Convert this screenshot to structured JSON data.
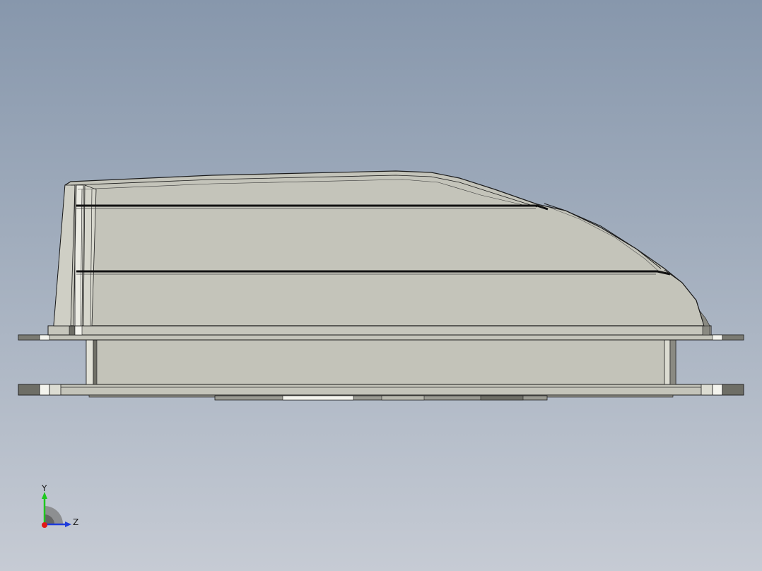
{
  "viewport": {
    "background_top": "#8797ac",
    "background_bottom": "#c6cbd4",
    "model": {
      "description_icon": "roof-vent-cover-model",
      "fill_color": "#c3c3b9",
      "edge_color": "#1b1b1b"
    }
  },
  "triad": {
    "y_label": "Y",
    "z_label": "Z",
    "y_color": "#1ec81e",
    "z_color": "#1e3cdc",
    "x_color": "#e01818"
  }
}
